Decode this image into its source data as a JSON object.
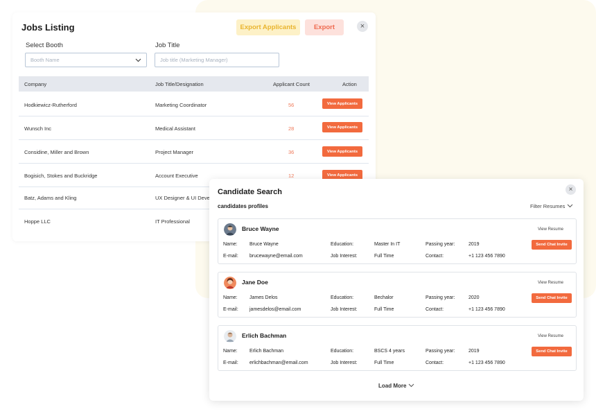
{
  "jobs": {
    "title": "Jobs Listing",
    "export_applicants": "Export Applicants",
    "export": "Export",
    "close": "×",
    "booth_label": "Select Booth",
    "booth_placeholder": "Booth Name",
    "jobtitle_label": "Job Title",
    "jobtitle_placeholder": "Job title (Marketing Manager)",
    "columns": [
      "Company",
      "Job Title/Designation",
      "Applicant Count",
      "Action"
    ],
    "rows": [
      {
        "company": "Hodkiewicz-Rutherford",
        "title": "Marketing Coordinator",
        "count": "56",
        "action": "View Applicants"
      },
      {
        "company": "Wunsch Inc",
        "title": "Medical Assistant",
        "count": "28",
        "action": "View Applicants"
      },
      {
        "company": "Considine, Miller and Brown",
        "title": "Project Manager",
        "count": "36",
        "action": "View Applicants"
      },
      {
        "company": "Bogisich, Stokes and Buckridge",
        "title": "Account Executive",
        "count": "12",
        "action": "View Applicants"
      },
      {
        "company": "Batz, Adams and Kling",
        "title": "UX Designer & UI Develo",
        "count": "",
        "action": ""
      },
      {
        "company": "Hoppe LLC",
        "title": "IT Professional",
        "count": "",
        "action": ""
      }
    ]
  },
  "candidate": {
    "title": "Candidate Search",
    "subtitle": "candidates profiles",
    "filter": "Filter Resumes",
    "close": "×",
    "labels": {
      "name": "Name:",
      "email": "E-mail:",
      "education": "Education:",
      "interest": "Job Interest:",
      "passing": "Passing year:",
      "contact": "Contact:"
    },
    "view_resume": "View Resume",
    "send_chat": "Send Chat Invite",
    "load_more": "Load More",
    "cards": [
      {
        "name": "Bruce Wayne",
        "full_name": "Bruce Wayne",
        "email": "brucewayne@email.com",
        "education": "Master In IT",
        "interest": "Full Time",
        "passing": "2019",
        "contact": "+1 123 456 7890"
      },
      {
        "name": "Jane Doe",
        "full_name": "James Delos",
        "email": "jamesdelos@email.com",
        "education": "Bechalor",
        "interest": "Full Time",
        "passing": "2020",
        "contact": "+1 123 456 7890"
      },
      {
        "name": "Erlich Bachman",
        "full_name": "Erlich Bachman",
        "email": "erlichbachman@email.com",
        "education": "BSCS 4 years",
        "interest": "Full Time",
        "passing": "2019",
        "contact": "+1 123 456 7890"
      }
    ]
  },
  "colors": {
    "accent": "#f26a3e",
    "export_bg": "#fde1dc",
    "export_applicants_bg": "#fdf1c7",
    "header_bg": "#e5e8ee"
  }
}
